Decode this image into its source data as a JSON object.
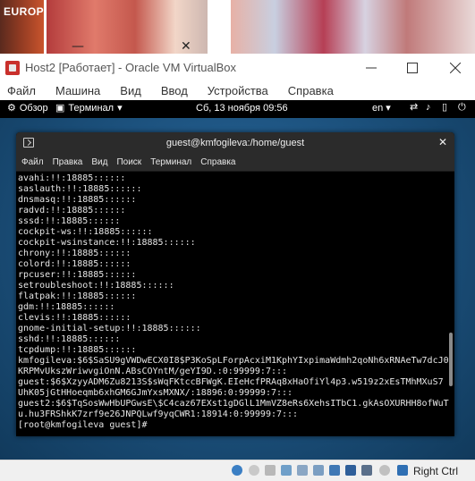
{
  "host_top": {
    "thumb_text": "EUROPE",
    "minimize_glyph": "—",
    "close_glyph": "✕"
  },
  "vbox": {
    "title": "Host2 [Работает] - Oracle VM VirtualBox",
    "menu": [
      "Файл",
      "Машина",
      "Вид",
      "Ввод",
      "Устройства",
      "Справка"
    ]
  },
  "gnome": {
    "activities": "Обзор",
    "app_menu": "Терминал",
    "clock": "Сб, 13 ноября  09:56",
    "lang": "en",
    "icons": [
      "activities-icon",
      "terminal-icon",
      "chevron-down-icon",
      "network-icon",
      "volume-icon",
      "battery-icon",
      "power-icon"
    ]
  },
  "terminal": {
    "title": "guest@kmfogileva:/home/guest",
    "menu": [
      "Файл",
      "Правка",
      "Вид",
      "Поиск",
      "Терминал",
      "Справка"
    ],
    "lines": [
      "avahi:!!:18885::::::",
      "saslauth:!!:18885::::::",
      "dnsmasq:!!:18885::::::",
      "radvd:!!:18885::::::",
      "sssd:!!:18885::::::",
      "cockpit-ws:!!:18885::::::",
      "cockpit-wsinstance:!!:18885::::::",
      "chrony:!!:18885::::::",
      "colord:!!:18885::::::",
      "rpcuser:!!:18885::::::",
      "setroubleshoot:!!:18885::::::",
      "flatpak:!!:18885::::::",
      "gdm:!!:18885::::::",
      "clevis:!!:18885::::::",
      "gnome-initial-setup:!!:18885::::::",
      "sshd:!!:18885::::::",
      "tcpdump:!!:18885::::::",
      "kmfogileva:$6$SaSU9gVWDwECX0I8$P3KoSpLForpAcxiM1KphYIxpimaWdmh2qoNh6xRNAeTw7dcJ0",
      "KRPMvUkszWriwvgiOnN.ABsCOYntM/geYI9D.:0:99999:7:::",
      "guest:$6$XzyyADM6Zu8213S$sWqFKtccBFWgK.EIeHcfPRAq8xHaOfiYl4p3.w519z2xEsTMhMXuS7",
      "UhK05jGtHHoeqmb6xhGM6GJmYxsMXNX/:18896:0:99999:7:::",
      "guest2:$6$TqSosWwHbUPGwsE\\$C4caz67EXst1gDGlL1MmVZ8eRs6XehsITbC1.gkAsOXURHH8ofWuT",
      "u.hu3FRShkK7zrf9e26JNPQLwf9yqCWR1:18914:0:99999:7:::",
      "[root@kmfogileva guest]# "
    ]
  },
  "statusbar": {
    "host_key": "Right Ctrl"
  }
}
